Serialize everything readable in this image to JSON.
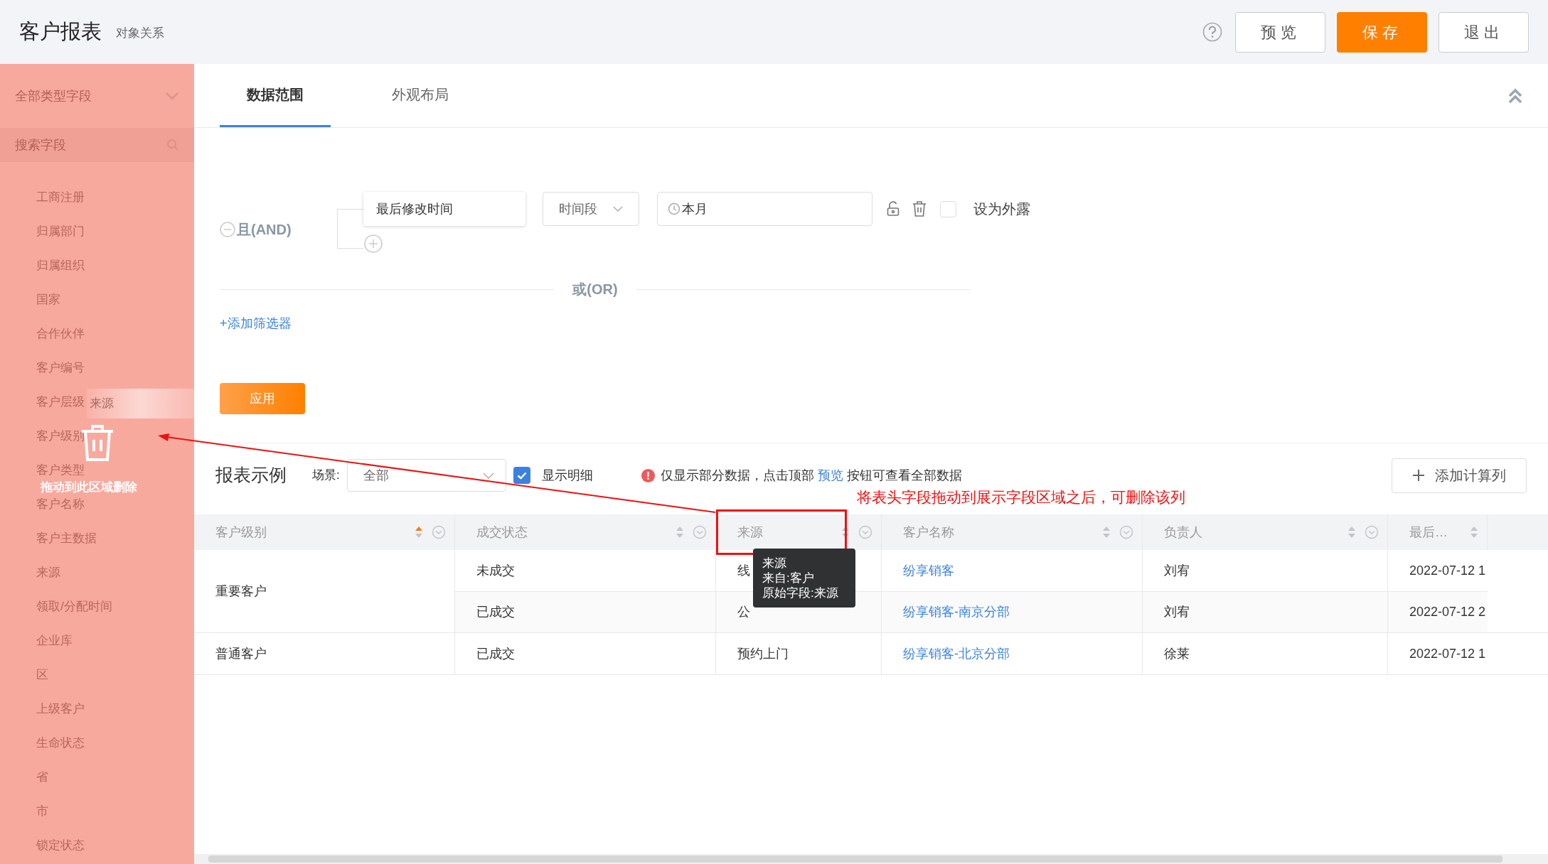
{
  "header": {
    "title": "客户报表",
    "subtitle": "对象关系",
    "buttons": [
      {
        "label": "预览",
        "kind": "default"
      },
      {
        "label": "保存",
        "kind": "primary"
      },
      {
        "label": "退出",
        "kind": "default"
      }
    ]
  },
  "sidebar": {
    "type_select": "全部类型字段",
    "search_placeholder": "搜索字段",
    "items": [
      "工商注册",
      "归属部门",
      "归属组织",
      "国家",
      "合作伙伴",
      "客户编号",
      "客户层级",
      "客户级别",
      "客户类型",
      "客户名称",
      "客户主数据",
      "来源",
      "领取/分配时间",
      "企业库",
      "区",
      "上级客户",
      "生命状态",
      "省",
      "市",
      "锁定状态"
    ],
    "drag_ghost": "来源",
    "drop_hint": "拖动到此区域删除"
  },
  "tabs": [
    {
      "label": "数据范围",
      "selected": true
    },
    {
      "label": "外观布局",
      "selected": false
    }
  ],
  "filter": {
    "and_label": "且(AND)",
    "conditions": [
      {
        "field": "最后修改时间",
        "operator": "时间段",
        "value": "本月",
        "exposed": false,
        "exposed_label": "设为外露"
      }
    ],
    "or_label": "或(OR)",
    "add_filter": "+添加筛选器",
    "apply": "应用"
  },
  "report": {
    "title": "报表示例",
    "scene_label": "场景:",
    "scene_value": "全部",
    "show_detail": {
      "label": "显示明细",
      "checked": true
    },
    "notice_before": "仅显示部分数据，点击顶部",
    "notice_link": "预览",
    "notice_after": "按钮可查看全部数据",
    "add_column": "添加计算列",
    "annotation": "将表头字段拖动到展示字段区域之后，可删除该列",
    "columns": [
      {
        "label": "客户级别",
        "sorted_asc": true,
        "annotated": false
      },
      {
        "label": "成交状态",
        "sorted_asc": false,
        "annotated": false
      },
      {
        "label": "来源",
        "sorted_asc": false,
        "annotated": true
      },
      {
        "label": "客户名称",
        "sorted_asc": false,
        "annotated": false
      },
      {
        "label": "负责人",
        "sorted_asc": false,
        "annotated": false
      },
      {
        "label": "最后…",
        "sorted_asc": false,
        "annotated": false
      }
    ],
    "groups": [
      {
        "level": "重要客户",
        "rows": [
          {
            "status": "未成交",
            "source": "线",
            "name": "纷享销客",
            "owner": "刘宥",
            "time": "2022-07-12 1"
          },
          {
            "status": "已成交",
            "source": "公",
            "name": "纷享销客-南京分部",
            "owner": "刘宥",
            "time": "2022-07-12 2"
          }
        ]
      },
      {
        "level": "普通客户",
        "rows": [
          {
            "status": "已成交",
            "source": "预约上门",
            "name": "纷享销客-北京分部",
            "owner": "徐莱",
            "time": "2022-07-12 1"
          }
        ]
      }
    ],
    "tooltip": [
      "来源",
      "来自:客户",
      "原始字段:来源"
    ]
  }
}
